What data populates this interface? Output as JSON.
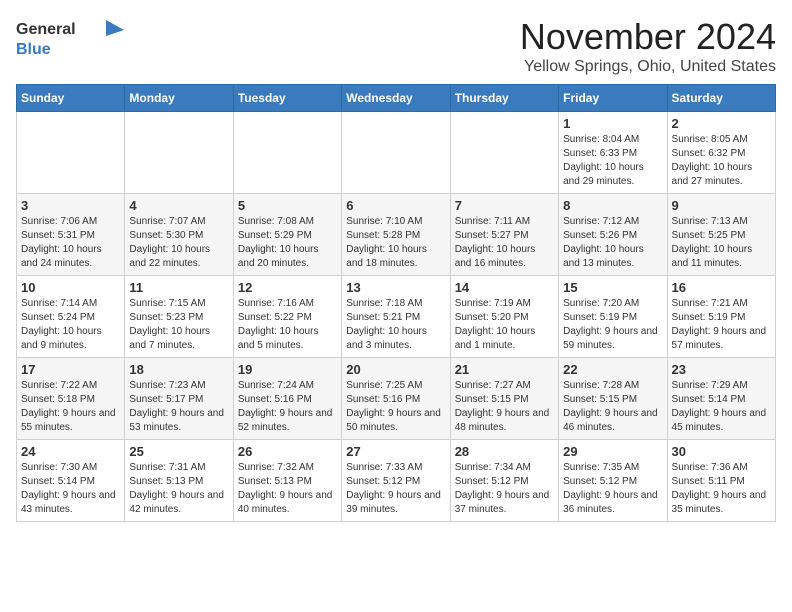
{
  "logo": {
    "general": "General",
    "blue": "Blue"
  },
  "title": "November 2024",
  "subtitle": "Yellow Springs, Ohio, United States",
  "days_of_week": [
    "Sunday",
    "Monday",
    "Tuesday",
    "Wednesday",
    "Thursday",
    "Friday",
    "Saturday"
  ],
  "weeks": [
    [
      {
        "day": "",
        "info": ""
      },
      {
        "day": "",
        "info": ""
      },
      {
        "day": "",
        "info": ""
      },
      {
        "day": "",
        "info": ""
      },
      {
        "day": "",
        "info": ""
      },
      {
        "day": "1",
        "info": "Sunrise: 8:04 AM\nSunset: 6:33 PM\nDaylight: 10 hours and 29 minutes."
      },
      {
        "day": "2",
        "info": "Sunrise: 8:05 AM\nSunset: 6:32 PM\nDaylight: 10 hours and 27 minutes."
      }
    ],
    [
      {
        "day": "3",
        "info": "Sunrise: 7:06 AM\nSunset: 5:31 PM\nDaylight: 10 hours and 24 minutes."
      },
      {
        "day": "4",
        "info": "Sunrise: 7:07 AM\nSunset: 5:30 PM\nDaylight: 10 hours and 22 minutes."
      },
      {
        "day": "5",
        "info": "Sunrise: 7:08 AM\nSunset: 5:29 PM\nDaylight: 10 hours and 20 minutes."
      },
      {
        "day": "6",
        "info": "Sunrise: 7:10 AM\nSunset: 5:28 PM\nDaylight: 10 hours and 18 minutes."
      },
      {
        "day": "7",
        "info": "Sunrise: 7:11 AM\nSunset: 5:27 PM\nDaylight: 10 hours and 16 minutes."
      },
      {
        "day": "8",
        "info": "Sunrise: 7:12 AM\nSunset: 5:26 PM\nDaylight: 10 hours and 13 minutes."
      },
      {
        "day": "9",
        "info": "Sunrise: 7:13 AM\nSunset: 5:25 PM\nDaylight: 10 hours and 11 minutes."
      }
    ],
    [
      {
        "day": "10",
        "info": "Sunrise: 7:14 AM\nSunset: 5:24 PM\nDaylight: 10 hours and 9 minutes."
      },
      {
        "day": "11",
        "info": "Sunrise: 7:15 AM\nSunset: 5:23 PM\nDaylight: 10 hours and 7 minutes."
      },
      {
        "day": "12",
        "info": "Sunrise: 7:16 AM\nSunset: 5:22 PM\nDaylight: 10 hours and 5 minutes."
      },
      {
        "day": "13",
        "info": "Sunrise: 7:18 AM\nSunset: 5:21 PM\nDaylight: 10 hours and 3 minutes."
      },
      {
        "day": "14",
        "info": "Sunrise: 7:19 AM\nSunset: 5:20 PM\nDaylight: 10 hours and 1 minute."
      },
      {
        "day": "15",
        "info": "Sunrise: 7:20 AM\nSunset: 5:19 PM\nDaylight: 9 hours and 59 minutes."
      },
      {
        "day": "16",
        "info": "Sunrise: 7:21 AM\nSunset: 5:19 PM\nDaylight: 9 hours and 57 minutes."
      }
    ],
    [
      {
        "day": "17",
        "info": "Sunrise: 7:22 AM\nSunset: 5:18 PM\nDaylight: 9 hours and 55 minutes."
      },
      {
        "day": "18",
        "info": "Sunrise: 7:23 AM\nSunset: 5:17 PM\nDaylight: 9 hours and 53 minutes."
      },
      {
        "day": "19",
        "info": "Sunrise: 7:24 AM\nSunset: 5:16 PM\nDaylight: 9 hours and 52 minutes."
      },
      {
        "day": "20",
        "info": "Sunrise: 7:25 AM\nSunset: 5:16 PM\nDaylight: 9 hours and 50 minutes."
      },
      {
        "day": "21",
        "info": "Sunrise: 7:27 AM\nSunset: 5:15 PM\nDaylight: 9 hours and 48 minutes."
      },
      {
        "day": "22",
        "info": "Sunrise: 7:28 AM\nSunset: 5:15 PM\nDaylight: 9 hours and 46 minutes."
      },
      {
        "day": "23",
        "info": "Sunrise: 7:29 AM\nSunset: 5:14 PM\nDaylight: 9 hours and 45 minutes."
      }
    ],
    [
      {
        "day": "24",
        "info": "Sunrise: 7:30 AM\nSunset: 5:14 PM\nDaylight: 9 hours and 43 minutes."
      },
      {
        "day": "25",
        "info": "Sunrise: 7:31 AM\nSunset: 5:13 PM\nDaylight: 9 hours and 42 minutes."
      },
      {
        "day": "26",
        "info": "Sunrise: 7:32 AM\nSunset: 5:13 PM\nDaylight: 9 hours and 40 minutes."
      },
      {
        "day": "27",
        "info": "Sunrise: 7:33 AM\nSunset: 5:12 PM\nDaylight: 9 hours and 39 minutes."
      },
      {
        "day": "28",
        "info": "Sunrise: 7:34 AM\nSunset: 5:12 PM\nDaylight: 9 hours and 37 minutes."
      },
      {
        "day": "29",
        "info": "Sunrise: 7:35 AM\nSunset: 5:12 PM\nDaylight: 9 hours and 36 minutes."
      },
      {
        "day": "30",
        "info": "Sunrise: 7:36 AM\nSunset: 5:11 PM\nDaylight: 9 hours and 35 minutes."
      }
    ]
  ]
}
